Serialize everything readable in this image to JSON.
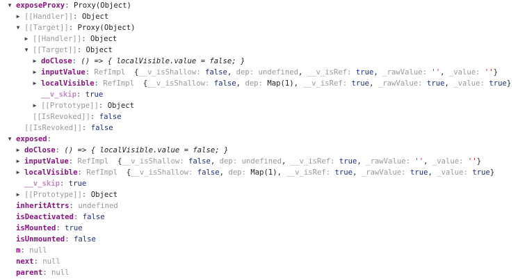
{
  "colors": {
    "key": "#881280",
    "boolean": "#1c2d80",
    "string": "#c41a16",
    "dim": "#999999"
  },
  "rows": [
    {
      "level": 0,
      "arrow": "open",
      "segs": [
        [
          "k",
          "exposeProxy"
        ],
        [
          "p",
          ": "
        ],
        [
          "o",
          "Proxy(Object)"
        ]
      ]
    },
    {
      "level": 1,
      "arrow": "closed",
      "segs": [
        [
          "i",
          "[[Handler]]"
        ],
        [
          "p",
          ": "
        ],
        [
          "o",
          "Object"
        ]
      ]
    },
    {
      "level": 1,
      "arrow": "open",
      "segs": [
        [
          "i",
          "[[Target]]"
        ],
        [
          "p",
          ": "
        ],
        [
          "o",
          "Proxy(Object)"
        ]
      ]
    },
    {
      "level": 2,
      "arrow": "closed",
      "segs": [
        [
          "i",
          "[[Handler]]"
        ],
        [
          "p",
          ": "
        ],
        [
          "o",
          "Object"
        ]
      ]
    },
    {
      "level": 2,
      "arrow": "open",
      "segs": [
        [
          "i",
          "[[Target]]"
        ],
        [
          "p",
          ": "
        ],
        [
          "o",
          "Object"
        ]
      ]
    },
    {
      "level": 3,
      "arrow": "closed",
      "segs": [
        [
          "k",
          "doClose"
        ],
        [
          "p",
          ": "
        ],
        [
          "f",
          "() => { localVisible.value = false; }"
        ]
      ]
    },
    {
      "level": 3,
      "arrow": "closed",
      "segs": [
        [
          "k",
          "inputValue"
        ],
        [
          "p",
          ": "
        ],
        [
          "g",
          "RefImpl  "
        ],
        [
          "o",
          "{"
        ],
        [
          "g",
          "__v_isShallow: "
        ],
        [
          "b",
          "false"
        ],
        [
          "o",
          ", "
        ],
        [
          "g",
          "dep: "
        ],
        [
          "n",
          "undefined"
        ],
        [
          "o",
          ", "
        ],
        [
          "g",
          "__v_isRef: "
        ],
        [
          "b",
          "true"
        ],
        [
          "o",
          ", "
        ],
        [
          "g",
          "_rawValue: "
        ],
        [
          "s",
          "''"
        ],
        [
          "o",
          ", "
        ],
        [
          "g",
          "_value: "
        ],
        [
          "s",
          "''"
        ],
        [
          "o",
          "}"
        ]
      ]
    },
    {
      "level": 3,
      "arrow": "closed",
      "segs": [
        [
          "k",
          "localVisible"
        ],
        [
          "p",
          ": "
        ],
        [
          "g",
          "RefImpl  "
        ],
        [
          "o",
          "{"
        ],
        [
          "g",
          "__v_isShallow: "
        ],
        [
          "b",
          "false"
        ],
        [
          "o",
          ", "
        ],
        [
          "g",
          "dep: "
        ],
        [
          "o",
          "Map(1)"
        ],
        [
          "o",
          ", "
        ],
        [
          "g",
          "__v_isRef: "
        ],
        [
          "b",
          "true"
        ],
        [
          "o",
          ", "
        ],
        [
          "g",
          "_rawValue: "
        ],
        [
          "b",
          "true"
        ],
        [
          "o",
          ", "
        ],
        [
          "g",
          "_value: "
        ],
        [
          "b",
          "true"
        ],
        [
          "o",
          "}"
        ]
      ]
    },
    {
      "level": 3,
      "arrow": "none",
      "segs": [
        [
          "kd",
          "__v_skip"
        ],
        [
          "p",
          ": "
        ],
        [
          "b",
          "true"
        ]
      ]
    },
    {
      "level": 3,
      "arrow": "closed",
      "segs": [
        [
          "i",
          "[[Prototype]]"
        ],
        [
          "p",
          ": "
        ],
        [
          "o",
          "Object"
        ]
      ]
    },
    {
      "level": 2,
      "arrow": "none",
      "segs": [
        [
          "i",
          "[[IsRevoked]]"
        ],
        [
          "p",
          ": "
        ],
        [
          "b",
          "false"
        ]
      ]
    },
    {
      "level": 1,
      "arrow": "none",
      "segs": [
        [
          "i",
          "[[IsRevoked]]"
        ],
        [
          "p",
          ": "
        ],
        [
          "b",
          "false"
        ]
      ]
    },
    {
      "level": 0,
      "arrow": "open",
      "segs": [
        [
          "k",
          "exposed"
        ],
        [
          "p",
          ":"
        ]
      ]
    },
    {
      "level": 1,
      "arrow": "closed",
      "segs": [
        [
          "k",
          "doClose"
        ],
        [
          "p",
          ": "
        ],
        [
          "f",
          "() => { localVisible.value = false; }"
        ]
      ]
    },
    {
      "level": 1,
      "arrow": "closed",
      "segs": [
        [
          "k",
          "inputValue"
        ],
        [
          "p",
          ": "
        ],
        [
          "g",
          "RefImpl  "
        ],
        [
          "o",
          "{"
        ],
        [
          "g",
          "__v_isShallow: "
        ],
        [
          "b",
          "false"
        ],
        [
          "o",
          ", "
        ],
        [
          "g",
          "dep: "
        ],
        [
          "n",
          "undefined"
        ],
        [
          "o",
          ", "
        ],
        [
          "g",
          "__v_isRef: "
        ],
        [
          "b",
          "true"
        ],
        [
          "o",
          ", "
        ],
        [
          "g",
          "_rawValue: "
        ],
        [
          "s",
          "''"
        ],
        [
          "o",
          ", "
        ],
        [
          "g",
          "_value: "
        ],
        [
          "s",
          "''"
        ],
        [
          "o",
          "}"
        ]
      ]
    },
    {
      "level": 1,
      "arrow": "closed",
      "segs": [
        [
          "k",
          "localVisible"
        ],
        [
          "p",
          ": "
        ],
        [
          "g",
          "RefImpl  "
        ],
        [
          "o",
          "{"
        ],
        [
          "g",
          "__v_isShallow: "
        ],
        [
          "b",
          "false"
        ],
        [
          "o",
          ", "
        ],
        [
          "g",
          "dep: "
        ],
        [
          "o",
          "Map(1)"
        ],
        [
          "o",
          ", "
        ],
        [
          "g",
          "__v_isRef: "
        ],
        [
          "b",
          "true"
        ],
        [
          "o",
          ", "
        ],
        [
          "g",
          "_rawValue: "
        ],
        [
          "b",
          "true"
        ],
        [
          "o",
          ", "
        ],
        [
          "g",
          "_value: "
        ],
        [
          "b",
          "true"
        ],
        [
          "o",
          "}"
        ]
      ]
    },
    {
      "level": 1,
      "arrow": "none",
      "segs": [
        [
          "kd",
          "__v_skip"
        ],
        [
          "p",
          ": "
        ],
        [
          "b",
          "true"
        ]
      ]
    },
    {
      "level": 1,
      "arrow": "closed",
      "segs": [
        [
          "i",
          "[[Prototype]]"
        ],
        [
          "p",
          ": "
        ],
        [
          "o",
          "Object"
        ]
      ]
    },
    {
      "level": 0,
      "arrow": "none",
      "segs": [
        [
          "k",
          "inheritAttrs"
        ],
        [
          "p",
          ": "
        ],
        [
          "n",
          "undefined"
        ]
      ]
    },
    {
      "level": 0,
      "arrow": "none",
      "segs": [
        [
          "k",
          "isDeactivated"
        ],
        [
          "p",
          ": "
        ],
        [
          "b",
          "false"
        ]
      ]
    },
    {
      "level": 0,
      "arrow": "none",
      "segs": [
        [
          "k",
          "isMounted"
        ],
        [
          "p",
          ": "
        ],
        [
          "b",
          "true"
        ]
      ]
    },
    {
      "level": 0,
      "arrow": "none",
      "segs": [
        [
          "k",
          "isUnmounted"
        ],
        [
          "p",
          ": "
        ],
        [
          "b",
          "false"
        ]
      ]
    },
    {
      "level": 0,
      "arrow": "none",
      "segs": [
        [
          "k",
          "m"
        ],
        [
          "p",
          ": "
        ],
        [
          "n",
          "null"
        ]
      ]
    },
    {
      "level": 0,
      "arrow": "none",
      "segs": [
        [
          "k",
          "next"
        ],
        [
          "p",
          ": "
        ],
        [
          "n",
          "null"
        ]
      ]
    },
    {
      "level": 0,
      "arrow": "none",
      "segs": [
        [
          "k",
          "parent"
        ],
        [
          "p",
          ": "
        ],
        [
          "n",
          "null"
        ]
      ]
    }
  ]
}
